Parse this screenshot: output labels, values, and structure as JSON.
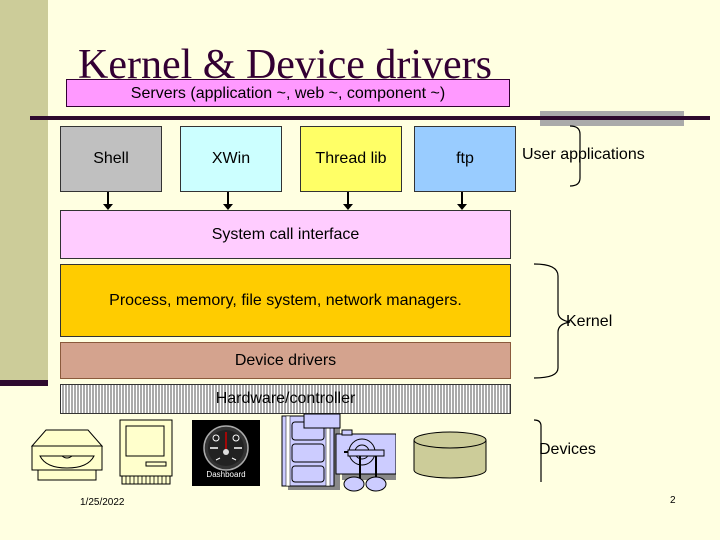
{
  "slide": {
    "title": "Kernel & Device drivers",
    "servers_label": "Servers (application ~, web ~, component ~)",
    "apps": [
      {
        "label": "Shell",
        "color": "#C0C0C0"
      },
      {
        "label": "XWin",
        "color": "#CCFFFF"
      },
      {
        "label": "Thread lib",
        "color": "#FFFF66"
      },
      {
        "label": "ftp",
        "color": "#99CCFF"
      }
    ],
    "syscall_label": "System call interface",
    "kernel_layer_label": "Process, memory, file system, network managers.",
    "drivers_label": "Device drivers",
    "hardware_label": "Hardware/controller",
    "brace_labels": {
      "user_apps": "User applications",
      "kernel": "Kernel",
      "devices": "Devices"
    },
    "device_icons": [
      "disk-drive-icon",
      "computer-icon",
      "dashboard-icon",
      "multimedia-icon",
      "database-icon"
    ],
    "dashboard_caption": "Dashboard",
    "footer": {
      "date": "1/25/2022",
      "page_number": "2"
    }
  }
}
